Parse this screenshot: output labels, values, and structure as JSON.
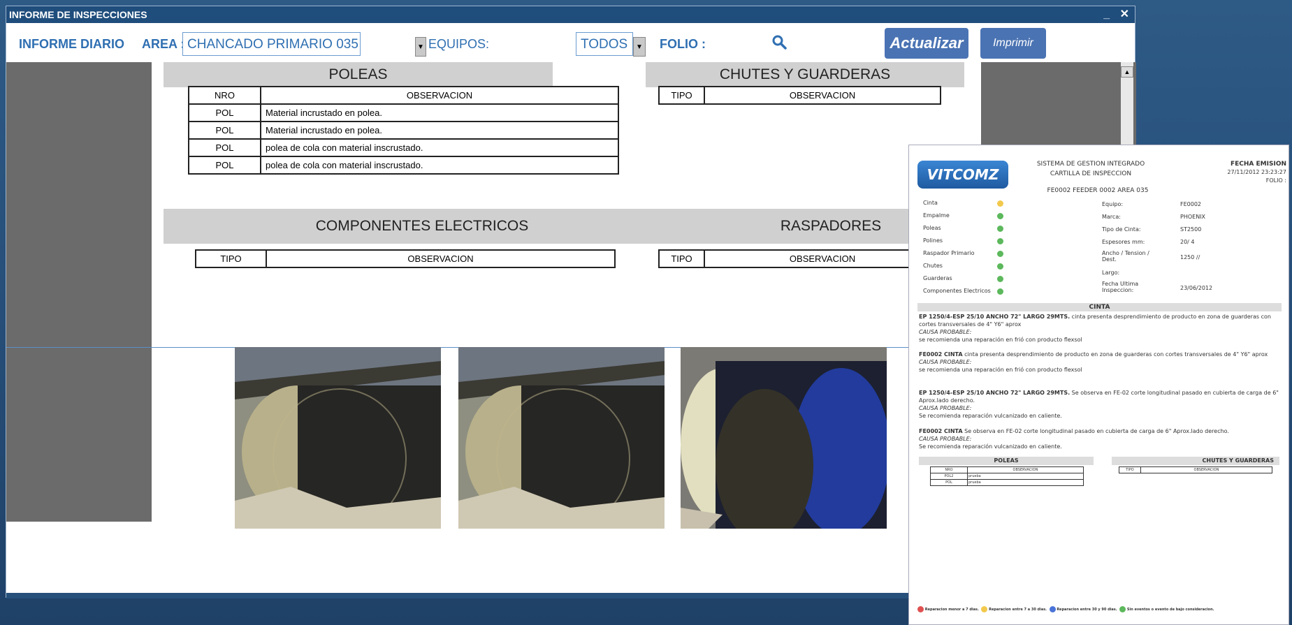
{
  "window": {
    "title": "INFORME DE INSPECCIONES",
    "minimize": "_",
    "close": "✕"
  },
  "toolbar": {
    "informe_label": "INFORME DIARIO",
    "area_label": "AREA :",
    "area_value": "CHANCADO PRIMARIO 035",
    "equipos_label": "EQUIPOS:",
    "equipos_value": "TODOS",
    "folio_label": "FOLIO :",
    "actualizar": "Actualizar",
    "imprimir": "Imprimir"
  },
  "poleas": {
    "title": "POLEAS",
    "headers": [
      "NRO",
      "OBSERVACION"
    ],
    "rows": [
      [
        "POL",
        "Material incrustado en polea."
      ],
      [
        "POL",
        "Material incrustado en polea."
      ],
      [
        "POL",
        "polea de cola con material inscrustado."
      ],
      [
        "POL",
        "polea de cola con material inscrustado."
      ]
    ]
  },
  "chutes": {
    "title": "CHUTES Y GUARDERAS",
    "headers": [
      "TIPO",
      "OBSERVACION"
    ]
  },
  "electricos": {
    "title": "COMPONENTES ELECTRICOS",
    "headers": [
      "TIPO",
      "OBSERVACION"
    ]
  },
  "raspadores": {
    "title": "RASPADORES",
    "headers": [
      "TIPO",
      "OBSERVACION"
    ]
  },
  "report": {
    "logo": "VITCOMZ",
    "system": "SISTEMA DE GESTION INTEGRADO",
    "cartilla": "CARTILLA DE INSPECCION",
    "fecha_label": "FECHA EMISION",
    "fecha_value": "27/11/2012 23:23:27",
    "folio": "FOLIO :",
    "equipo_header": "FE0002  FEEDER 0002 AREA 035",
    "components": [
      {
        "name": "Cinta",
        "color": "#f2c94c"
      },
      {
        "name": "Empalme",
        "color": "#5cb85c"
      },
      {
        "name": "Poleas",
        "color": "#5cb85c"
      },
      {
        "name": "Polines",
        "color": "#5cb85c"
      },
      {
        "name": "Raspador Primario",
        "color": "#5cb85c"
      },
      {
        "name": "Chutes",
        "color": "#5cb85c"
      },
      {
        "name": "Guarderas",
        "color": "#5cb85c"
      },
      {
        "name": "Componentes Electricos",
        "color": "#5cb85c"
      }
    ],
    "details": [
      [
        "Equipo:",
        "FE0002"
      ],
      [
        "Marca:",
        "PHOENIX"
      ],
      [
        "Tipo de Cinta:",
        "ST2500"
      ],
      [
        "Espesores mm:",
        "20/ 4"
      ],
      [
        "Ancho / Tension / Dest.",
        "1250 //"
      ],
      [
        "Largo:",
        ""
      ],
      [
        "Fecha Ultima Inspeccion:",
        "23/06/2012"
      ]
    ],
    "cinta_title": "CINTA",
    "obs": [
      {
        "head": "EP 1250/4-ESP 25/10 ANCHO 72\" LARGO 29MTS.",
        "text": "cinta presenta desprendimiento de producto en zona de guarderas con cortes transversales de 4\" Y6\" aprox",
        "causa": "CAUSA PROBABLE:",
        "rec": "se recomienda una reparación en frió con producto flexsol"
      },
      {
        "head": "FE0002 CINTA",
        "text": "cinta presenta desprendimiento de producto en zona de guarderas con cortes transversales de 4\" Y6\" aprox",
        "causa": "CAUSA PROBABLE:",
        "rec": "se recomienda una reparación en frió con producto flexsol"
      },
      {
        "head": "EP 1250/4-ESP 25/10 ANCHO 72\" LARGO 29MTS.",
        "text": "Se observa en FE-02 corte longitudinal pasado en cubierta de carga de 6\" Aprox.lado derecho.",
        "causa": "CAUSA PROBABLE:",
        "rec": "Se recomienda reparación vulcanizado en caliente."
      },
      {
        "head": "FE0002 CINTA",
        "text": "Se observa en FE-02 corte longitudinal pasado en cubierta de carga de 6\" Aprox.lado derecho.",
        "causa": "CAUSA PROBABLE:",
        "rec": "Se recomienda reparación vulcanizado en caliente."
      }
    ],
    "poleas_title": "POLEAS",
    "poleas_headers": [
      "NRO",
      "OBSERVACION"
    ],
    "poleas_rows": [
      [
        "POL2",
        "prueba"
      ],
      [
        "POL",
        "prueba"
      ]
    ],
    "chutes_title": "CHUTES Y GUARDERAS",
    "chutes_headers": [
      "TIPO",
      "OBSERVACION"
    ],
    "legend": [
      {
        "label": "Reparacion menor a 7 dias.",
        "color": "#e05050"
      },
      {
        "label": "Reparacion entre 7 a 30 dias.",
        "color": "#f2c94c"
      },
      {
        "label": "Reparacion entre 30 y 90 dias.",
        "color": "#4a73d8"
      },
      {
        "label": "Sin eventos o evento de bajo consideracion.",
        "color": "#5cb85c"
      }
    ]
  }
}
